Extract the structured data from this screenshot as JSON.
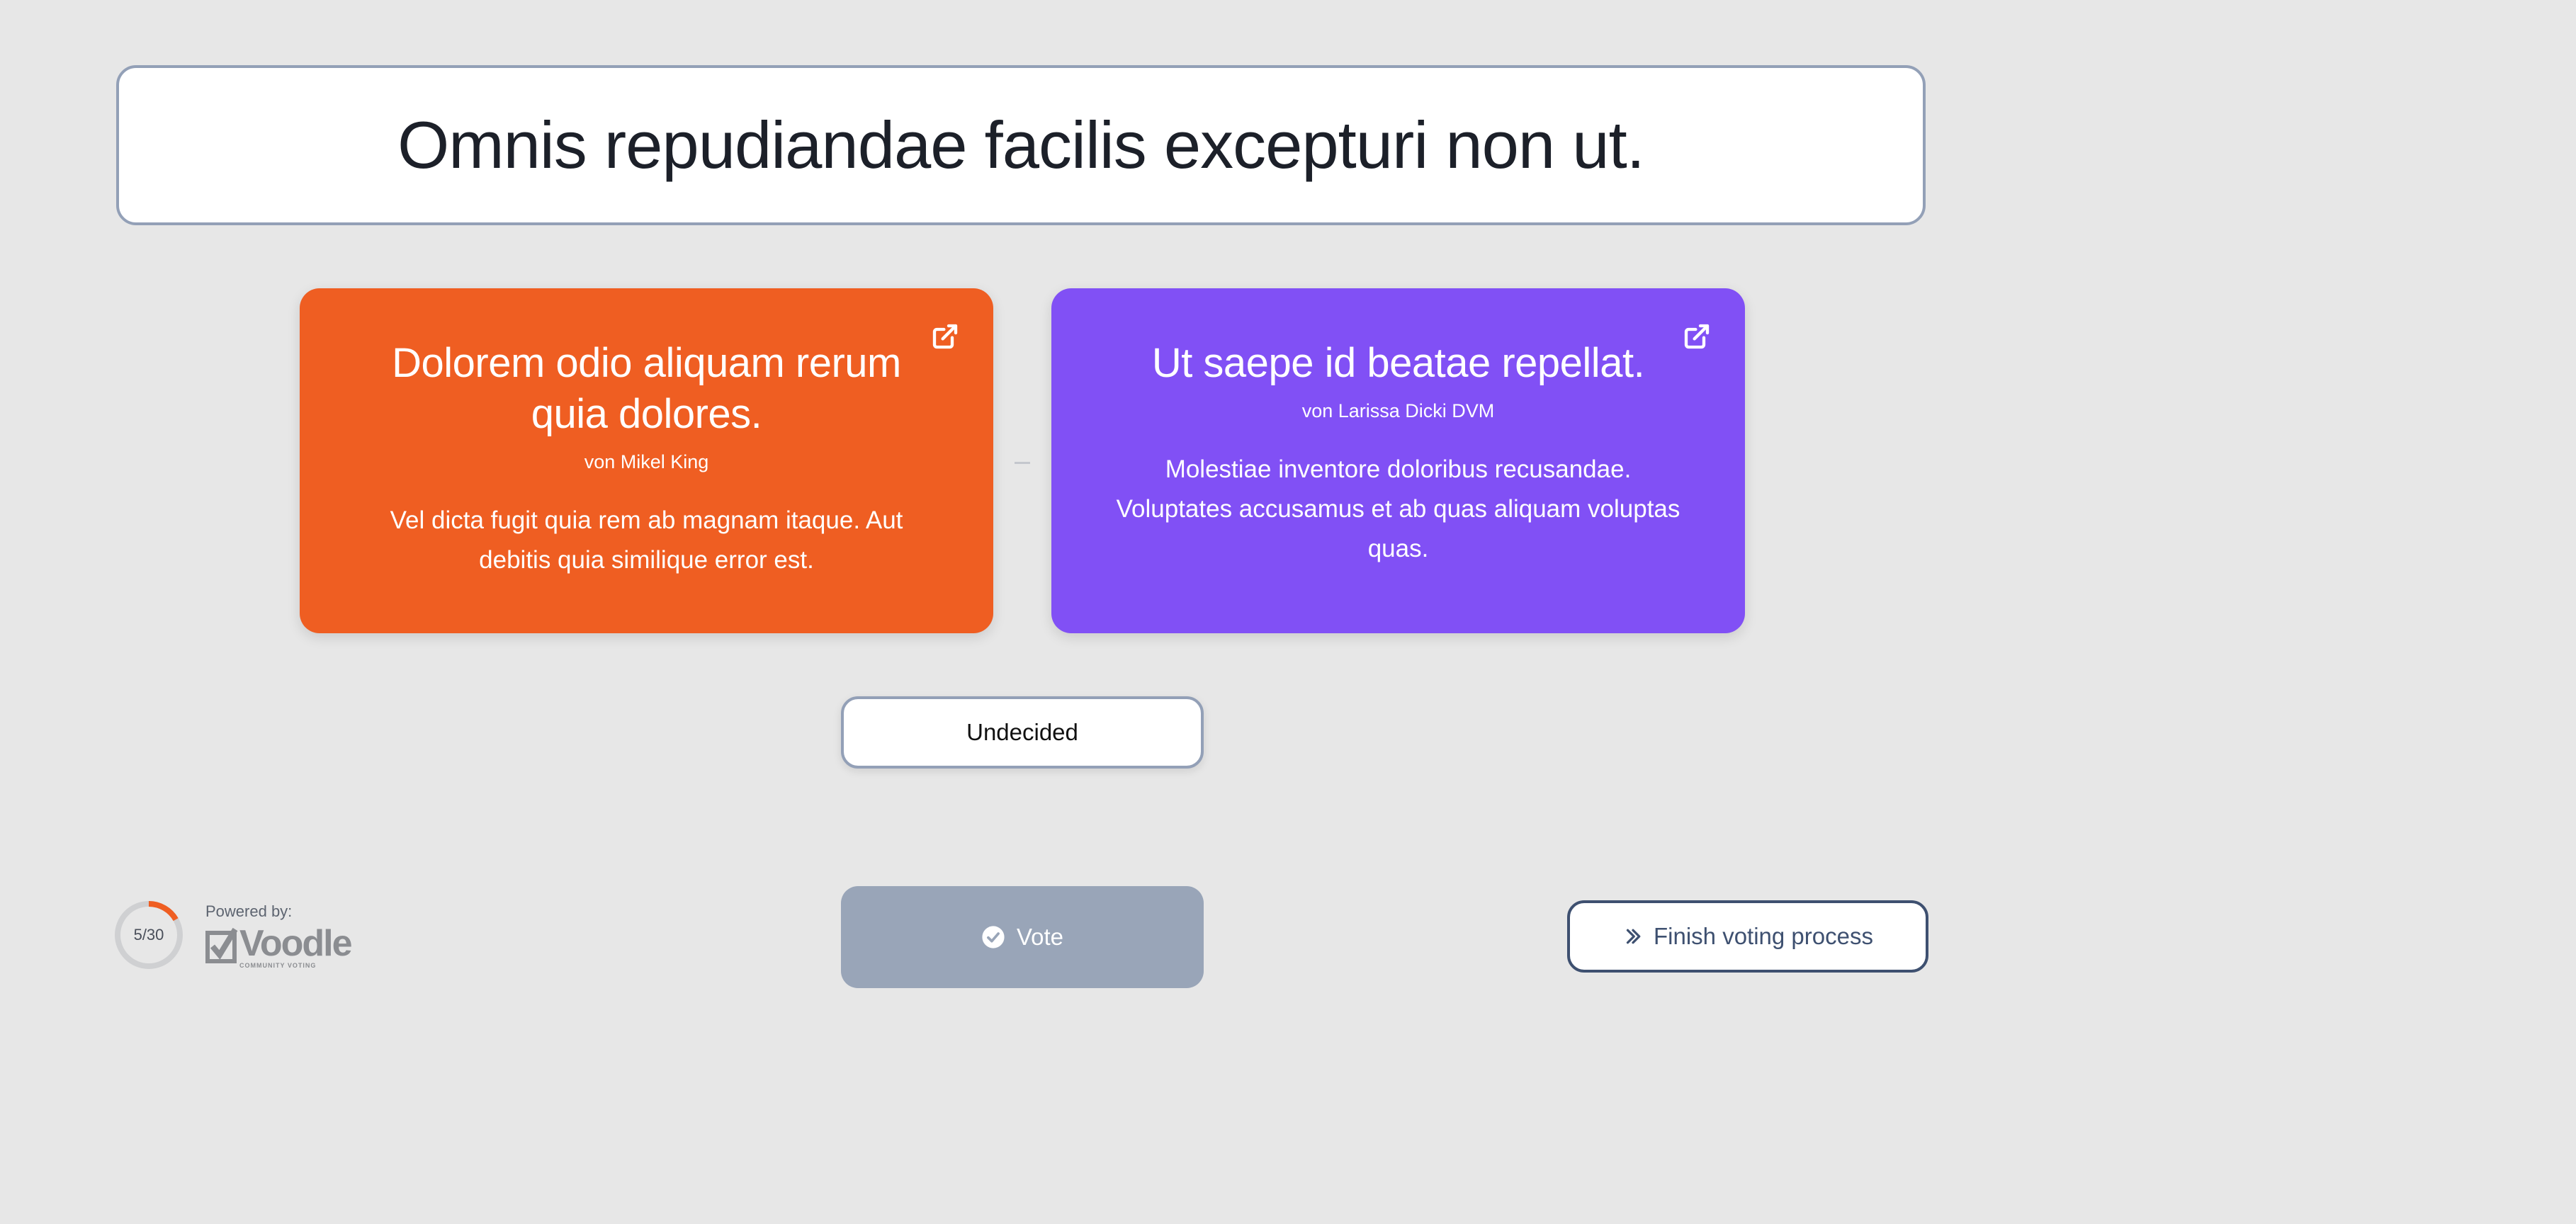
{
  "question": {
    "title": "Omnis repudiandae facilis excepturi non ut."
  },
  "options": [
    {
      "title": "Dolorem odio aliquam rerum quia dolores.",
      "author": "von Mikel King",
      "description": "Vel dicta fugit quia rem ab magnam itaque. Aut debitis quia similique error est.",
      "color": "#ef5e22",
      "icon": "external-link-icon"
    },
    {
      "title": "Ut saepe id beatae repellat.",
      "author": "von Larissa Dicki DVM",
      "description": "Molestiae inventore doloribus recusandae. Voluptates accusamus et ab quas aliquam voluptas quas.",
      "color": "#8150f5",
      "icon": "external-link-icon"
    }
  ],
  "undecided_label": "Undecided",
  "progress": {
    "current": 5,
    "total": 30,
    "label": "5/30",
    "color": "#ef5e22"
  },
  "powered_by": {
    "label": "Powered by:",
    "logo_text": "Voodle",
    "logo_subtitle": "COMMUNITY VOTING"
  },
  "vote_button": {
    "label": "Vote",
    "icon": "check-circle-icon"
  },
  "finish_button": {
    "label": "Finish voting process",
    "icon": "double-chevron-right-icon"
  }
}
